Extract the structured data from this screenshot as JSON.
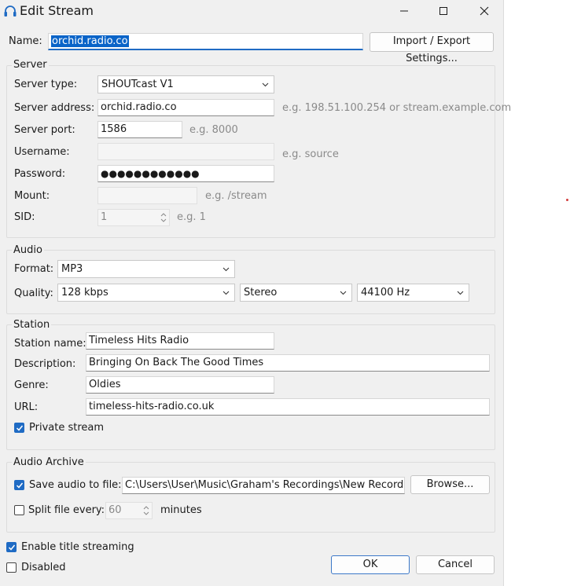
{
  "window": {
    "title": "Edit Stream"
  },
  "name_row": {
    "label": "Name:",
    "value": "orchid.radio.co",
    "import_export_button": "Import / Export Settings..."
  },
  "server": {
    "group_title": "Server",
    "server_type": {
      "label": "Server type:",
      "value": "SHOUTcast V1"
    },
    "server_address": {
      "label": "Server address:",
      "value": "orchid.radio.co",
      "hint": "e.g. 198.51.100.254 or stream.example.com"
    },
    "server_port": {
      "label": "Server port:",
      "value": "1586",
      "hint": "e.g. 8000"
    },
    "username": {
      "label": "Username:",
      "value": "",
      "hint": "e.g. source"
    },
    "password": {
      "label": "Password:",
      "value": "●●●●●●●●●●●●"
    },
    "mount": {
      "label": "Mount:",
      "value": "",
      "hint": "e.g. /stream"
    },
    "sid": {
      "label": "SID:",
      "value": "1",
      "hint": "e.g. 1"
    }
  },
  "audio": {
    "group_title": "Audio",
    "format": {
      "label": "Format:",
      "value": "MP3"
    },
    "quality": {
      "label": "Quality:",
      "bitrate": "128 kbps",
      "channels": "Stereo",
      "sample_rate": "44100 Hz"
    }
  },
  "station": {
    "group_title": "Station",
    "station_name": {
      "label": "Station name:",
      "value": "Timeless Hits Radio"
    },
    "description": {
      "label": "Description:",
      "value": "Bringing On Back The Good Times"
    },
    "genre": {
      "label": "Genre:",
      "value": "Oldies"
    },
    "url": {
      "label": "URL:",
      "value": "timeless-hits-radio.co.uk"
    },
    "private_stream": {
      "label": "Private stream",
      "checked": true
    }
  },
  "archive": {
    "group_title": "Audio Archive",
    "save_audio": {
      "label": "Save audio to file:",
      "checked": true,
      "path": "C:\\Users\\User\\Music\\Graham's Recordings\\New Recording",
      "browse_button": "Browse..."
    },
    "split_file": {
      "label": "Split file every:",
      "checked": false,
      "value": "60",
      "unit": "minutes"
    }
  },
  "footer": {
    "enable_title_streaming": {
      "label": "Enable title streaming",
      "checked": true
    },
    "disabled": {
      "label": "Disabled",
      "checked": false
    },
    "ok_button": "OK",
    "cancel_button": "Cancel"
  },
  "colors": {
    "accent": "#1f6bc4",
    "selection": "#0a64c8",
    "dialog_bg": "#f0f0f0",
    "hint_text": "#8a8a8a"
  }
}
